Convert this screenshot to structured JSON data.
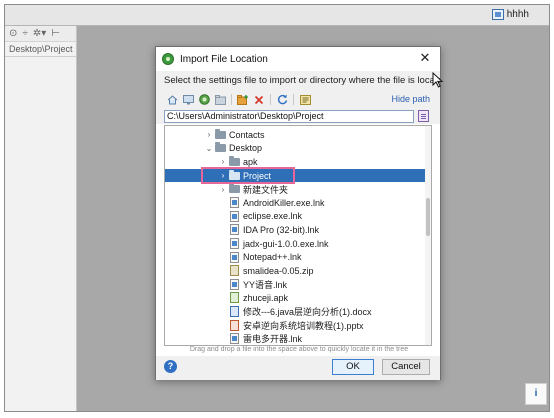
{
  "ide": {
    "user_name": "hhhh",
    "panel_tab_label": "Desktop\\Project",
    "corner_button_label": "i"
  },
  "dialog": {
    "title": "Import File Location",
    "close_glyph": "✕",
    "description": "Select the settings file to import or directory where the file is located",
    "hide_path_label": "Hide path",
    "path_value": "C:\\Users\\Administrator\\Desktop\\Project",
    "drag_hint": "Drag and drop a file into the space above to quickly locate it in the tree",
    "ok_label": "OK",
    "cancel_label": "Cancel",
    "help_glyph": "?"
  },
  "toolbar_icons": [
    "home-icon",
    "desktop-icon",
    "project-icon",
    "module-icon",
    "new-folder-icon",
    "delete-icon",
    "refresh-icon",
    "show-hidden-icon"
  ],
  "tree": [
    {
      "label": "Contacts",
      "indent": 1,
      "arrow": "›",
      "icon": "folder",
      "selected": false
    },
    {
      "label": "Desktop",
      "indent": 1,
      "arrow": "⌄",
      "icon": "folder",
      "selected": false
    },
    {
      "label": "apk",
      "indent": 2,
      "arrow": "›",
      "icon": "folder",
      "selected": false
    },
    {
      "label": "Project",
      "indent": 2,
      "arrow": "›",
      "icon": "folder",
      "selected": true
    },
    {
      "label": "新建文件夹",
      "indent": 2,
      "arrow": "›",
      "icon": "folder",
      "selected": false
    },
    {
      "label": "AndroidKiller.exe.lnk",
      "indent": 2,
      "arrow": "",
      "icon": "lnk",
      "selected": false
    },
    {
      "label": "eclipse.exe.lnk",
      "indent": 2,
      "arrow": "",
      "icon": "lnk",
      "selected": false
    },
    {
      "label": "IDA Pro (32-bit).lnk",
      "indent": 2,
      "arrow": "",
      "icon": "lnk",
      "selected": false
    },
    {
      "label": "jadx-gui-1.0.0.exe.lnk",
      "indent": 2,
      "arrow": "",
      "icon": "lnk",
      "selected": false
    },
    {
      "label": "Notepad++.lnk",
      "indent": 2,
      "arrow": "",
      "icon": "lnk",
      "selected": false
    },
    {
      "label": "smalidea-0.05.zip",
      "indent": 2,
      "arrow": "",
      "icon": "zip",
      "selected": false
    },
    {
      "label": "YY语音.lnk",
      "indent": 2,
      "arrow": "",
      "icon": "lnk",
      "selected": false
    },
    {
      "label": "zhuceji.apk",
      "indent": 2,
      "arrow": "",
      "icon": "apk",
      "selected": false
    },
    {
      "label": "修改---6.java层逆向分析(1).docx",
      "indent": 2,
      "arrow": "",
      "icon": "doc",
      "selected": false
    },
    {
      "label": "安卓逆向系统培训教程(1).pptx",
      "indent": 2,
      "arrow": "",
      "icon": "ppt",
      "selected": false
    },
    {
      "label": "雷电多开器.lnk",
      "indent": 2,
      "arrow": "",
      "icon": "lnk",
      "selected": false
    }
  ]
}
